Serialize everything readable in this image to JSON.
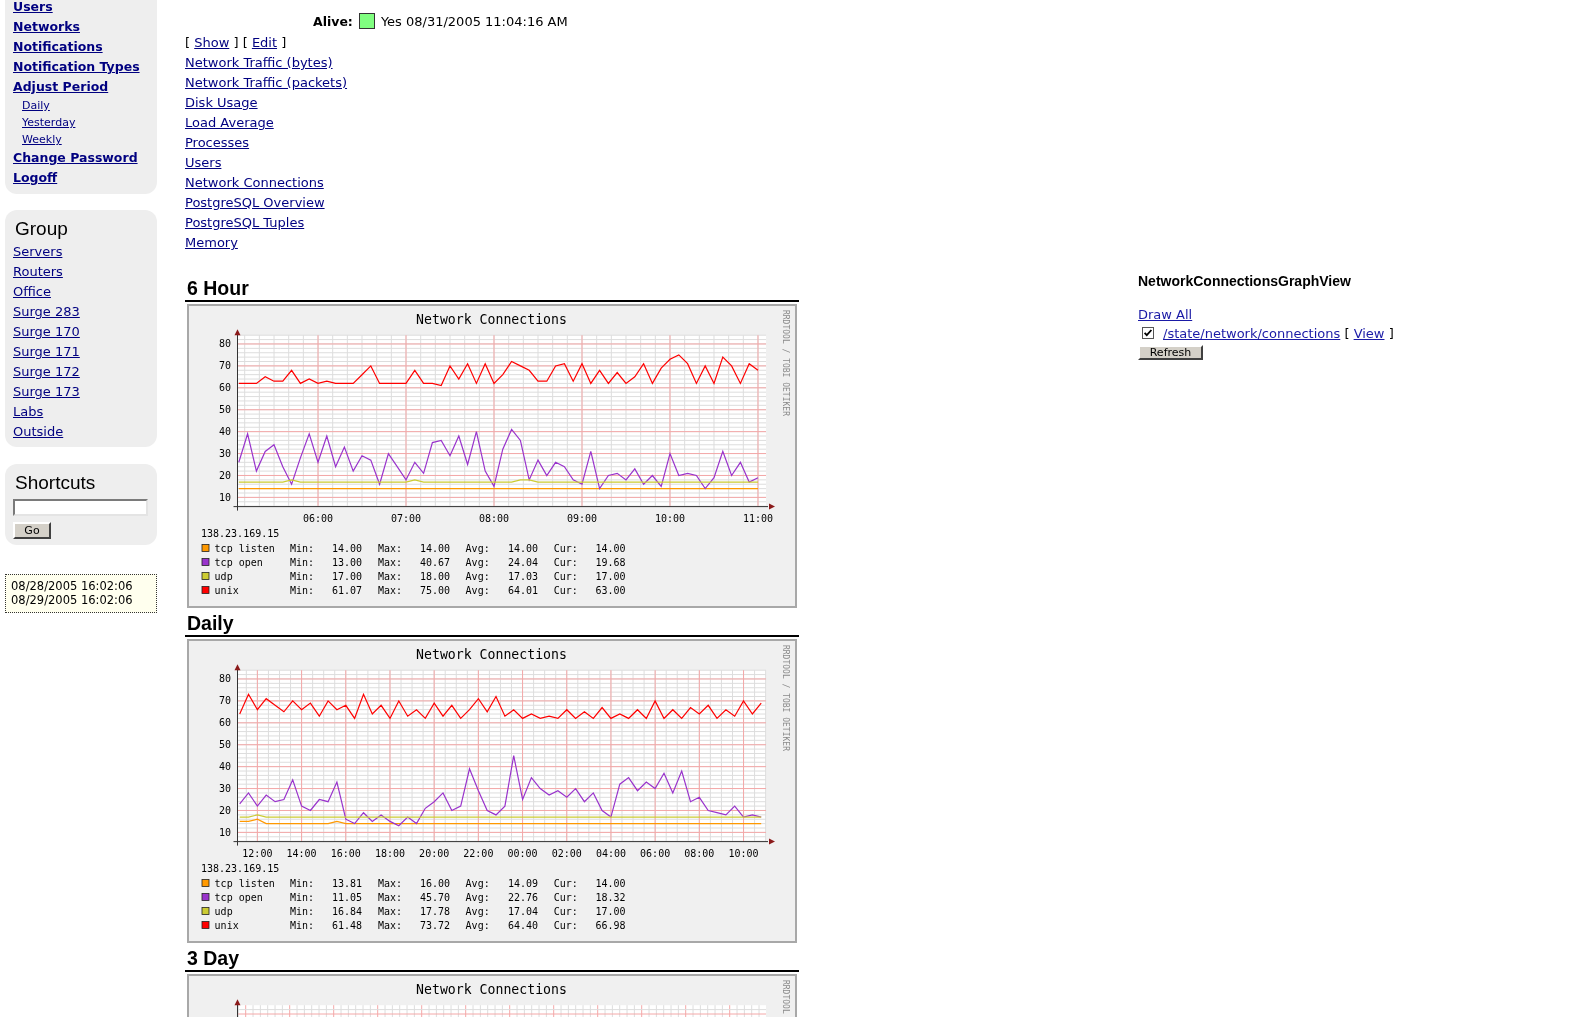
{
  "sidebar": {
    "nav": [
      {
        "label": "Users",
        "kind": "main"
      },
      {
        "label": "Networks",
        "kind": "main"
      },
      {
        "label": "Notifications",
        "kind": "main"
      },
      {
        "label": "Notification Types",
        "kind": "main"
      },
      {
        "label": "Adjust Period",
        "kind": "main"
      },
      {
        "label": "Daily",
        "kind": "sub"
      },
      {
        "label": "Yesterday",
        "kind": "sub"
      },
      {
        "label": "Weekly",
        "kind": "sub"
      },
      {
        "label": "Change Password",
        "kind": "main"
      },
      {
        "label": "Logoff",
        "kind": "main"
      }
    ],
    "group": {
      "title": "Group",
      "items": [
        "Servers",
        "Routers",
        "Office",
        "Surge 283",
        "Surge 170",
        "Surge 171",
        "Surge 172",
        "Surge 173",
        "Labs",
        "Outside"
      ]
    },
    "shortcuts": {
      "title": "Shortcuts",
      "button": "Go"
    },
    "period": [
      "08/28/2005 16:02:06",
      "08/29/2005 16:02:06"
    ]
  },
  "host": {
    "label": "Alive:",
    "alive": true,
    "value": "Yes 08/31/2005 11:04:16 AM"
  },
  "actions": [
    {
      "before": "[",
      "label": "Show",
      "after": "]"
    },
    {
      "before": "[",
      "label": "Edit",
      "after": "]"
    }
  ],
  "graph_links": [
    "Network Traffic (bytes)",
    "Network Traffic (packets)",
    "Disk Usage",
    "Load Average",
    "Processes",
    "Users",
    "Network Connections",
    "PostgreSQL Overview",
    "PostgreSQL Tuples",
    "Memory"
  ],
  "graphs": [
    {
      "heading": "6 Hour",
      "credit": "RRDTOOL / TOBI OETIKER",
      "chart_data": {
        "type": "line",
        "title": "Network Connections",
        "x": [
          5.1,
          5.2,
          5.3,
          5.4,
          5.5,
          5.6,
          5.7,
          5.8,
          5.9,
          6,
          6.1,
          6.2,
          6.3,
          6.4,
          6.5,
          6.6,
          6.7,
          6.8,
          6.9,
          7,
          7.1,
          7.2,
          7.3,
          7.4,
          7.5,
          7.6,
          7.7,
          7.8,
          7.9,
          8,
          8.1,
          8.2,
          8.3,
          8.4,
          8.5,
          8.6,
          8.7,
          8.8,
          8.9,
          9,
          9.1,
          9.2,
          9.3,
          9.4,
          9.5,
          9.6,
          9.7,
          9.8,
          9.9,
          10,
          10.1,
          10.2,
          10.3,
          10.4,
          10.5,
          10.6,
          10.7,
          10.8,
          10.9,
          11
        ],
        "series": [
          {
            "name": "tcp listen",
            "color": "#ff9900",
            "values": [
              14,
              14,
              14,
              14,
              14,
              14,
              14,
              14,
              14,
              14,
              14,
              14,
              14,
              14,
              14,
              14,
              14,
              14,
              14,
              14,
              14,
              14,
              14,
              14,
              14,
              14,
              14,
              14,
              14,
              14,
              14,
              14,
              14,
              14,
              14,
              14,
              14,
              14,
              14,
              14,
              14,
              14,
              14,
              14,
              14,
              14,
              14,
              14,
              14,
              14,
              14,
              14,
              14,
              14,
              14,
              14,
              14,
              14,
              14,
              14
            ]
          },
          {
            "name": "tcp open",
            "color": "#9933cc",
            "values": [
              26,
              39,
              22,
              31,
              34,
              24,
              16,
              28,
              39,
              26,
              38,
              24,
              33,
              22,
              29,
              27,
              16,
              30,
              24,
              18,
              26,
              21,
              35,
              36,
              29,
              38,
              25,
              40,
              22,
              15,
              32,
              41,
              36,
              18,
              27,
              20,
              26,
              24,
              18,
              16,
              31,
              14,
              20,
              21,
              18,
              23,
              16,
              20,
              15,
              30,
              20,
              21,
              20,
              14,
              19,
              31,
              20,
              26,
              17,
              19
            ]
          },
          {
            "name": "udp",
            "color": "#cccc33",
            "values": [
              17,
              17,
              17,
              17,
              17,
              17,
              18,
              17,
              17,
              17,
              17,
              17,
              17,
              17,
              17,
              17,
              17,
              17,
              17,
              17,
              18,
              17,
              17,
              17,
              17,
              17,
              17,
              17,
              17,
              17,
              17,
              17,
              18,
              18,
              17,
              17,
              17,
              17,
              17,
              17,
              17,
              17,
              17,
              17,
              17,
              17,
              17,
              17,
              17,
              17,
              17,
              17,
              17,
              17,
              17,
              17,
              17,
              17,
              17,
              17
            ]
          },
          {
            "name": "unix",
            "color": "#ff0000",
            "values": [
              62,
              62,
              62,
              65,
              63,
              63,
              68,
              62,
              64,
              62,
              63,
              62,
              62,
              62,
              66,
              70,
              62,
              62,
              62,
              62,
              68,
              62,
              62,
              61,
              70,
              64,
              71,
              62,
              71,
              62,
              66,
              72,
              70,
              68,
              63,
              63,
              70,
              71,
              63,
              71,
              62,
              68,
              62,
              67,
              62,
              65,
              71,
              62,
              69,
              73,
              75,
              71,
              62,
              70,
              62,
              74,
              70,
              62,
              71,
              68
            ]
          }
        ],
        "xlim": [
          5.085,
          11.091
        ],
        "ylim": [
          5.8,
          84
        ],
        "xticks": [
          {
            "value": 6,
            "label": "06:00"
          },
          {
            "value": 7,
            "label": "07:00"
          },
          {
            "value": 8,
            "label": "08:00"
          },
          {
            "value": 9,
            "label": "09:00"
          },
          {
            "value": 10,
            "label": "10:00"
          },
          {
            "value": 11,
            "label": "11:00"
          }
        ],
        "yticks": [
          10,
          20,
          30,
          40,
          50,
          60,
          70,
          80
        ],
        "grid": true,
        "legend": "bottom"
      },
      "legend_table": {
        "host": "138.23.169.15",
        "rows": [
          {
            "stats": [
              {
                "label": "Min:",
                "value": "14.00"
              },
              {
                "label": "Max:",
                "value": "14.00"
              },
              {
                "label": "Avg:",
                "value": "14.00"
              },
              {
                "label": "Cur:",
                "value": "14.00"
              }
            ]
          },
          {
            "stats": [
              {
                "label": "Min:",
                "value": "13.00"
              },
              {
                "label": "Max:",
                "value": "40.67"
              },
              {
                "label": "Avg:",
                "value": "24.04"
              },
              {
                "label": "Cur:",
                "value": "19.68"
              }
            ]
          },
          {
            "stats": [
              {
                "label": "Min:",
                "value": "17.00"
              },
              {
                "label": "Max:",
                "value": "18.00"
              },
              {
                "label": "Avg:",
                "value": "17.03"
              },
              {
                "label": "Cur:",
                "value": "17.00"
              }
            ]
          },
          {
            "stats": [
              {
                "label": "Min:",
                "value": "61.07"
              },
              {
                "label": "Max:",
                "value": "75.00"
              },
              {
                "label": "Avg:",
                "value": "64.01"
              },
              {
                "label": "Cur:",
                "value": "63.00"
              }
            ]
          }
        ]
      }
    },
    {
      "heading": "Daily",
      "credit": "RRDTOOL / TOBI OETIKER",
      "chart_data": {
        "type": "line",
        "title": "Network Connections",
        "x": [
          "2005-08-30T11:12",
          "2005-08-30T11:36",
          "2005-08-30T12:00",
          "2005-08-30T12:24",
          "2005-08-30T12:48",
          "2005-08-30T13:12",
          "2005-08-30T13:36",
          "2005-08-30T14:00",
          "2005-08-30T14:24",
          "2005-08-30T14:48",
          "2005-08-30T15:12",
          "2005-08-30T15:36",
          "2005-08-30T16:00",
          "2005-08-30T16:24",
          "2005-08-30T16:48",
          "2005-08-30T17:12",
          "2005-08-30T17:36",
          "2005-08-30T18:00",
          "2005-08-30T18:24",
          "2005-08-30T18:48",
          "2005-08-30T19:12",
          "2005-08-30T19:36",
          "2005-08-30T20:00",
          "2005-08-30T20:24",
          "2005-08-30T20:48",
          "2005-08-30T21:12",
          "2005-08-30T21:36",
          "2005-08-30T22:00",
          "2005-08-30T22:24",
          "2005-08-30T22:48",
          "2005-08-30T23:12",
          "2005-08-30T23:36",
          "2005-08-31T00:00",
          "2005-08-31T00:24",
          "2005-08-31T00:48",
          "2005-08-31T01:12",
          "2005-08-31T01:36",
          "2005-08-31T02:00",
          "2005-08-31T02:24",
          "2005-08-31T02:48",
          "2005-08-31T03:12",
          "2005-08-31T03:36",
          "2005-08-31T04:00",
          "2005-08-31T04:24",
          "2005-08-31T04:48",
          "2005-08-31T05:12",
          "2005-08-31T05:36",
          "2005-08-31T06:00",
          "2005-08-31T06:24",
          "2005-08-31T06:48",
          "2005-08-31T07:12",
          "2005-08-31T07:36",
          "2005-08-31T08:00",
          "2005-08-31T08:24",
          "2005-08-31T08:48",
          "2005-08-31T09:12",
          "2005-08-31T09:36",
          "2005-08-31T10:00",
          "2005-08-31T10:24",
          "2005-08-31T10:48"
        ],
        "series": [
          {
            "name": "tcp listen",
            "color": "#ff9900",
            "values": [
              15,
              15,
              16,
              14,
              14,
              14,
              14,
              14,
              14,
              14,
              14,
              15,
              14,
              14,
              14,
              14,
              14,
              14,
              14,
              14,
              14,
              14,
              14,
              14,
              14,
              14,
              14,
              14,
              14,
              14,
              14,
              14,
              14,
              14,
              14,
              14,
              14,
              14,
              14,
              14,
              14,
              14,
              14,
              14,
              14,
              14,
              14,
              14,
              14,
              14,
              14,
              14,
              14,
              14,
              14,
              14,
              14,
              14,
              14,
              14
            ]
          },
          {
            "name": "tcp open",
            "color": "#9933cc",
            "values": [
              23,
              28,
              22,
              27,
              24,
              25,
              34,
              22,
              20,
              25,
              24,
              33,
              16,
              14,
              19,
              15,
              18,
              15,
              13,
              17,
              14,
              21,
              24,
              28,
              20,
              22,
              39,
              29,
              20,
              18,
              22,
              45,
              25,
              35,
              30,
              27,
              29,
              26,
              30,
              24,
              28,
              20,
              17,
              32,
              35,
              29,
              33,
              30,
              37,
              28,
              38,
              24,
              26,
              20,
              19,
              18,
              22,
              17,
              18,
              17
            ]
          },
          {
            "name": "udp",
            "color": "#cccc33",
            "values": [
              17,
              17,
              18,
              17,
              17,
              17,
              17,
              17,
              17,
              17,
              17,
              17,
              17,
              17,
              17,
              17,
              17,
              17,
              17,
              17,
              17,
              17,
              17,
              17,
              17,
              17,
              17,
              17,
              17,
              17,
              17,
              17,
              17,
              17,
              17,
              17,
              17,
              17,
              17,
              17,
              17,
              17,
              17,
              17,
              17,
              17,
              17,
              17,
              17,
              17,
              17,
              17,
              17,
              17,
              17,
              17,
              17,
              17,
              17,
              17
            ]
          },
          {
            "name": "unix",
            "color": "#ff0000",
            "values": [
              64,
              73,
              66,
              71,
              68,
              65,
              70,
              66,
              69,
              63,
              70,
              66,
              68,
              62,
              73,
              64,
              68,
              62,
              70,
              63,
              66,
              62,
              69,
              63,
              68,
              62,
              66,
              71,
              65,
              72,
              63,
              66,
              62,
              64,
              62,
              63,
              62,
              66,
              62,
              65,
              62,
              67,
              62,
              64,
              62,
              66,
              62,
              70,
              62,
              66,
              62,
              67,
              64,
              68,
              62,
              66,
              63,
              70,
              64,
              69
            ]
          }
        ],
        "xlim": [
          "2005-08-30T11:06",
          "2005-08-31T11:01"
        ],
        "ylim": [
          5.8,
          84
        ],
        "xticks": [
          {
            "value": "2005-08-30T12:00",
            "label": "12:00"
          },
          {
            "value": "2005-08-30T14:00",
            "label": "14:00"
          },
          {
            "value": "2005-08-30T16:00",
            "label": "16:00"
          },
          {
            "value": "2005-08-30T18:00",
            "label": "18:00"
          },
          {
            "value": "2005-08-30T20:00",
            "label": "20:00"
          },
          {
            "value": "2005-08-30T22:00",
            "label": "22:00"
          },
          {
            "value": "2005-08-31T00:00",
            "label": "00:00"
          },
          {
            "value": "2005-08-31T02:00",
            "label": "02:00"
          },
          {
            "value": "2005-08-31T04:00",
            "label": "04:00"
          },
          {
            "value": "2005-08-31T06:00",
            "label": "06:00"
          },
          {
            "value": "2005-08-31T08:00",
            "label": "08:00"
          },
          {
            "value": "2005-08-31T10:00",
            "label": "10:00"
          }
        ],
        "yticks": [
          10,
          20,
          30,
          40,
          50,
          60,
          70,
          80
        ],
        "grid": true,
        "legend": "bottom"
      },
      "legend_table": {
        "host": "138.23.169.15",
        "rows": [
          {
            "stats": [
              {
                "label": "Min:",
                "value": "13.81"
              },
              {
                "label": "Max:",
                "value": "16.00"
              },
              {
                "label": "Avg:",
                "value": "14.09"
              },
              {
                "label": "Cur:",
                "value": "14.00"
              }
            ]
          },
          {
            "stats": [
              {
                "label": "Min:",
                "value": "11.05"
              },
              {
                "label": "Max:",
                "value": "45.70"
              },
              {
                "label": "Avg:",
                "value": "22.76"
              },
              {
                "label": "Cur:",
                "value": "18.32"
              }
            ]
          },
          {
            "stats": [
              {
                "label": "Min:",
                "value": "16.84"
              },
              {
                "label": "Max:",
                "value": "17.78"
              },
              {
                "label": "Avg:",
                "value": "17.04"
              },
              {
                "label": "Cur:",
                "value": "17.00"
              }
            ]
          },
          {
            "stats": [
              {
                "label": "Min:",
                "value": "61.48"
              },
              {
                "label": "Max:",
                "value": "73.72"
              },
              {
                "label": "Avg:",
                "value": "64.40"
              },
              {
                "label": "Cur:",
                "value": "66.98"
              }
            ]
          }
        ]
      }
    },
    {
      "heading": "3 Day",
      "title": "Network Connections",
      "credit": "RRDTOOL"
    }
  ],
  "graph_panel": {
    "title": "NetworkConnectionsGraphView",
    "draw_all": "Draw All",
    "sources": [
      {
        "checked": true,
        "path": "/state/network/connections",
        "before": "[",
        "label": "View",
        "after": "]"
      }
    ],
    "button": "Refresh"
  }
}
